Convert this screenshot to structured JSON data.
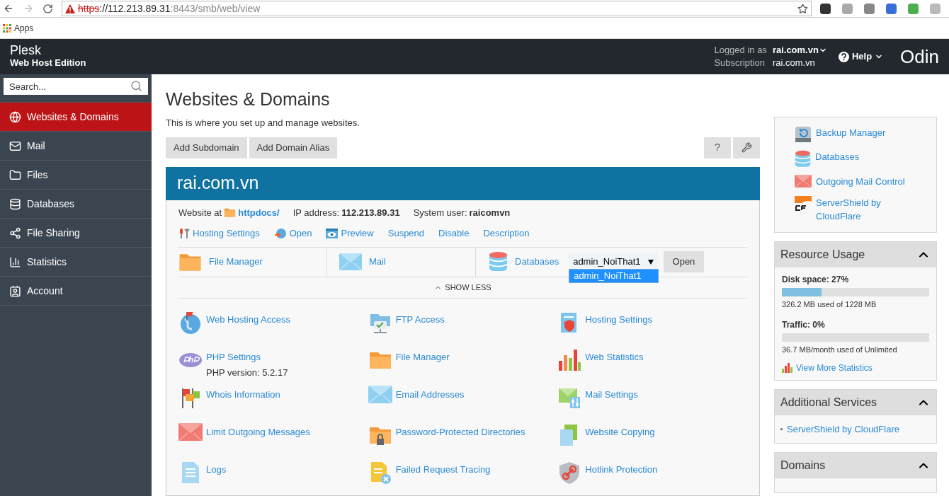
{
  "browser": {
    "url_scheme": "https",
    "url_host": "://112.213.89.31",
    "url_path": ":8443/smb/web/view",
    "bookmarks": [
      "Apps"
    ]
  },
  "header": {
    "product": "Plesk",
    "edition": "Web Host Edition",
    "logged_in_label": "Logged in as",
    "logged_in_user": "rai.com.vn",
    "subscription_label": "Subscription",
    "subscription": "rai.com.vn",
    "help": "Help",
    "brand": "Odin"
  },
  "sidebar": {
    "search_placeholder": "Search...",
    "items": [
      {
        "label": "Websites & Domains",
        "selected": true
      },
      {
        "label": "Mail",
        "selected": false
      },
      {
        "label": "Files",
        "selected": false
      },
      {
        "label": "Databases",
        "selected": false
      },
      {
        "label": "File Sharing",
        "selected": false
      },
      {
        "label": "Statistics",
        "selected": false
      },
      {
        "label": "Account",
        "selected": false
      }
    ]
  },
  "page": {
    "title": "Websites & Domains",
    "description": "This is where you set up and manage websites.",
    "buttons": [
      "Add Subdomain",
      "Add Domain Alias"
    ],
    "help_button": "?"
  },
  "domain": {
    "name": "rai.com.vn",
    "website_at_label": "Website at",
    "website_at": "httpdocs/",
    "ip_label": "IP address:",
    "ip": "112.213.89.31",
    "user_label": "System user:",
    "user": "raicomvn",
    "actions": [
      "Hosting Settings",
      "Open",
      "Preview",
      "Suspend",
      "Disable",
      "Description"
    ],
    "quick": [
      {
        "kind": "folder",
        "label": "File Manager"
      },
      {
        "kind": "mail",
        "label": "Mail"
      },
      {
        "kind": "database",
        "label": "Databases"
      }
    ],
    "db_select": {
      "value": "admin_NoiThat1",
      "expanded": true,
      "options": [
        {
          "label": "admin_NoiThat1",
          "selected": true
        }
      ]
    },
    "open_button": "Open",
    "show_less": "SHOW LESS",
    "tools": [
      {
        "label": "Web Hosting Access"
      },
      {
        "label": "FTP Access"
      },
      {
        "label": "Hosting Settings"
      },
      {
        "label": "PHP Settings",
        "note": "PHP version: 5.2.17"
      },
      {
        "label": "File Manager"
      },
      {
        "label": "Web Statistics"
      },
      {
        "label": "Whois Information"
      },
      {
        "label": "Email Addresses"
      },
      {
        "label": "Mail Settings"
      },
      {
        "label": "Limit Outgoing Messages"
      },
      {
        "label": "Password-Protected Directories"
      },
      {
        "label": "Website Copying"
      },
      {
        "label": "Logs"
      },
      {
        "label": "Failed Request Tracing"
      },
      {
        "label": "Hotlink Protection"
      }
    ]
  },
  "right": {
    "links": [
      "Backup Manager",
      "Databases",
      "Outgoing Mail Control",
      "ServerShield by CloudFlare"
    ],
    "resource_usage": {
      "title": "Resource Usage",
      "expanded": true,
      "meters": [
        {
          "label": "Disk space: 27%",
          "level": 0.27,
          "reading": "326.2 MB used of 1228 MB"
        },
        {
          "label": "Traffic: 0%",
          "level": 0,
          "reading": "36.7 MB/month used of Unlimited"
        }
      ],
      "more_link": "View More Statistics"
    },
    "additional_services": {
      "title": "Additional Services",
      "expanded": true,
      "items": [
        "ServerShield by CloudFlare"
      ]
    },
    "domains": {
      "title": "Domains",
      "expanded": true
    }
  }
}
